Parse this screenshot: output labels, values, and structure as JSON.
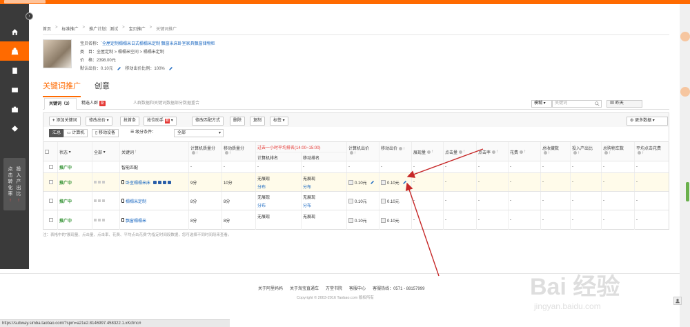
{
  "sidebar": {
    "collapse_symbol": "›",
    "nav_icons": [
      "home-icon",
      "shop-bag-icon",
      "document-icon",
      "card-icon",
      "toolbox-icon",
      "diamond-icon"
    ],
    "ratio_col1": "点击转化率",
    "ratio_col2": "投入产出比",
    "ratio_arrows": "↑"
  },
  "breadcrumb": {
    "home": "首页",
    "standard": "标准推广",
    "plan": "推广计划：测试",
    "product": "宝贝推广",
    "current": "关键词推广"
  },
  "product": {
    "name_label": "宝贝名称：",
    "name_value": "`全屋定制榻榻米日式榻榻米定制 飘窗米床卧室家具飘窗储物柜",
    "category_label": "类　目：",
    "category_value": "全屋定制 > 榻榻米空间 > 榻榻米定制",
    "price_label": "价　格：",
    "price_value": "2398.00元",
    "default_bid_label": "默认出价：",
    "default_bid_value": "0.10元",
    "mobile_ratio_label": "移动出价比例：",
    "mobile_ratio_value": "100%"
  },
  "main_tabs": {
    "keyword": "关键词推广",
    "creative": "创意"
  },
  "subtabs": {
    "keywords": "关键词（3）",
    "audience": "精选人群",
    "audience_badge": "新",
    "note": "人群数据和关键词数据部分数据重合"
  },
  "search": {
    "mode": "模糊",
    "placeholder": "关键词",
    "date": "昨天"
  },
  "toolbar": {
    "add": "添加关键词",
    "modify_bid": "修改出价",
    "grab": "抢首条",
    "rank": "抢位助手",
    "rank_badge": "新",
    "match": "修改匹配方式",
    "delete": "删除",
    "copy": "复制",
    "tag": "标签",
    "more": "更多数据"
  },
  "filter": {
    "all": "汇总",
    "pc": "计算机",
    "mobile": "移动设备",
    "level_label": "级分条件：",
    "level_value": "全部"
  },
  "table": {
    "headers": {
      "status": "状态",
      "all": "全部",
      "keyword": "关键词",
      "pc_quality": "计算机质量分",
      "mobile_quality": "移动质量分",
      "recent_note": "过去一小时平均排名(14:00~15:00)",
      "pc_rank": "计算机排名",
      "mobile_rank": "移动排名",
      "pc_bid": "计算机出价",
      "mobile_bid": "移动出价",
      "impressions": "展现量",
      "clicks": "点击量",
      "ctr": "点击率",
      "spend": "花费",
      "fav": "总收藏数",
      "roi": "投入产出比",
      "cart": "总购物车数",
      "avg_cpc": "平均点击花费"
    },
    "rows": [
      {
        "status": "推广中",
        "keyword": "智能匹配",
        "pc_q": "-",
        "m_q": "-",
        "pc_rank": "-",
        "m_rank": "-",
        "pc_bid": "-",
        "m_bid": "-",
        "impr": "-",
        "clicks": "-",
        "ctr": "-",
        "spend": "-",
        "fav": "-",
        "roi": "-",
        "cart": "-",
        "cpc": "-"
      },
      {
        "status": "推广中",
        "keyword": "卧室榻榻米床",
        "pc_q": "9分",
        "m_q": "10分",
        "pc_rank": "无展现",
        "pc_rank_sub": "分布",
        "m_rank": "无展现",
        "m_rank_sub": "分布",
        "pc_bid": "0.10元",
        "m_bid": "0.10元",
        "impr": "-",
        "clicks": "-",
        "ctr": "-",
        "spend": "-",
        "fav": "-",
        "roi": "-",
        "cart": "-",
        "cpc": "-"
      },
      {
        "status": "推广中",
        "keyword": "榻榻米定制",
        "pc_q": "8分",
        "m_q": "8分",
        "pc_rank": "无展现",
        "pc_rank_sub": "分布",
        "m_rank": "无展现",
        "m_rank_sub": "分布",
        "pc_bid": "0.10元",
        "m_bid": "0.10元",
        "impr": "-",
        "clicks": "-",
        "ctr": "-",
        "spend": "-",
        "fav": "-",
        "roi": "-",
        "cart": "-",
        "cpc": "-"
      },
      {
        "status": "推广中",
        "keyword": "飘窗榻榻米",
        "pc_q": "8分",
        "m_q": "8分",
        "pc_rank": "无展现",
        "m_rank": "无展现",
        "pc_bid": "0.10元",
        "m_bid": "0.10元",
        "impr": "-",
        "clicks": "-",
        "ctr": "-",
        "spend": "-",
        "fav": "-",
        "roi": "-",
        "cart": "-",
        "cpc": "-"
      }
    ]
  },
  "footnote": "注：表格中的\"展现量、点击量、点击率、花费、平均点击花费\"为指定时间段数据，您可选择不同时间段来查看。",
  "footer": {
    "link1": "关于阿里妈妈",
    "link2": "关于淘宝直通车",
    "link3": "万堂书院",
    "link4": "客服中心",
    "hotline": "客服热线：0571 - 88157999",
    "copyright": "Copyright © 2003-2016 Taobao.com 版权所有"
  },
  "statusbar_url": "https://subway.simba.taobao.com/?spm=a21e2.8146997.458322.1.xKcfmc#",
  "watermark": {
    "main": "Bai 经验",
    "sub": "jingyan.baidu.com"
  },
  "colors": {
    "accent": "#ff6a00",
    "status_green": "#2f8f2f",
    "link_blue": "#1f6bc2",
    "annotation_red": "#c62828"
  }
}
